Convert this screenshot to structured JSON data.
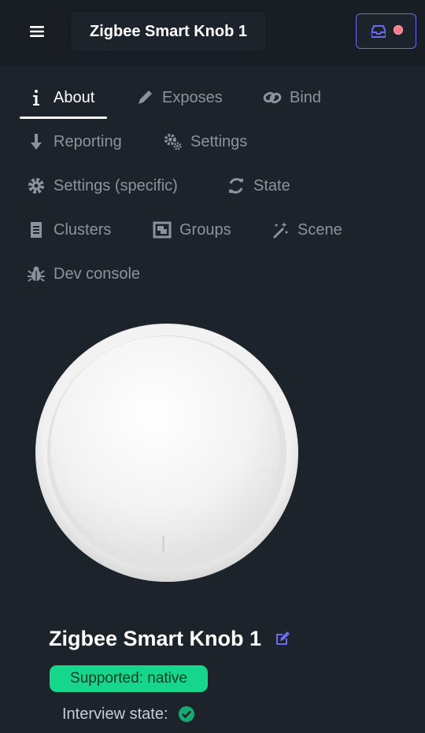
{
  "header": {
    "title": "Zigbee Smart Knob 1",
    "menu_icon": "hamburger-icon",
    "notifications_icon": "inbox-icon",
    "status_dot_color": "#f87a8d",
    "accent_color": "#6b6bf0"
  },
  "tabs": [
    {
      "label": "About",
      "icon": "info-icon",
      "active": true
    },
    {
      "label": "Exposes",
      "icon": "pencil-icon"
    },
    {
      "label": "Bind",
      "icon": "link-icon"
    },
    {
      "label": "Reporting",
      "icon": "download-arrow-icon"
    },
    {
      "label": "Settings",
      "icon": "gears-icon"
    },
    {
      "label": "Settings (specific)",
      "icon": "gear-icon"
    },
    {
      "label": "State",
      "icon": "refresh-icon"
    },
    {
      "label": "Clusters",
      "icon": "receipt-icon"
    },
    {
      "label": "Groups",
      "icon": "object-group-icon"
    },
    {
      "label": "Scene",
      "icon": "magic-wand-icon"
    },
    {
      "label": "Dev console",
      "icon": "bug-icon"
    }
  ],
  "device": {
    "name": "Zigbee Smart Knob 1",
    "support_badge": "Supported: native",
    "support_color": "#16d68c",
    "interview_label": "Interview state:",
    "interview_status_icon": "check-circle-icon",
    "interview_status_color": "#16a974"
  }
}
